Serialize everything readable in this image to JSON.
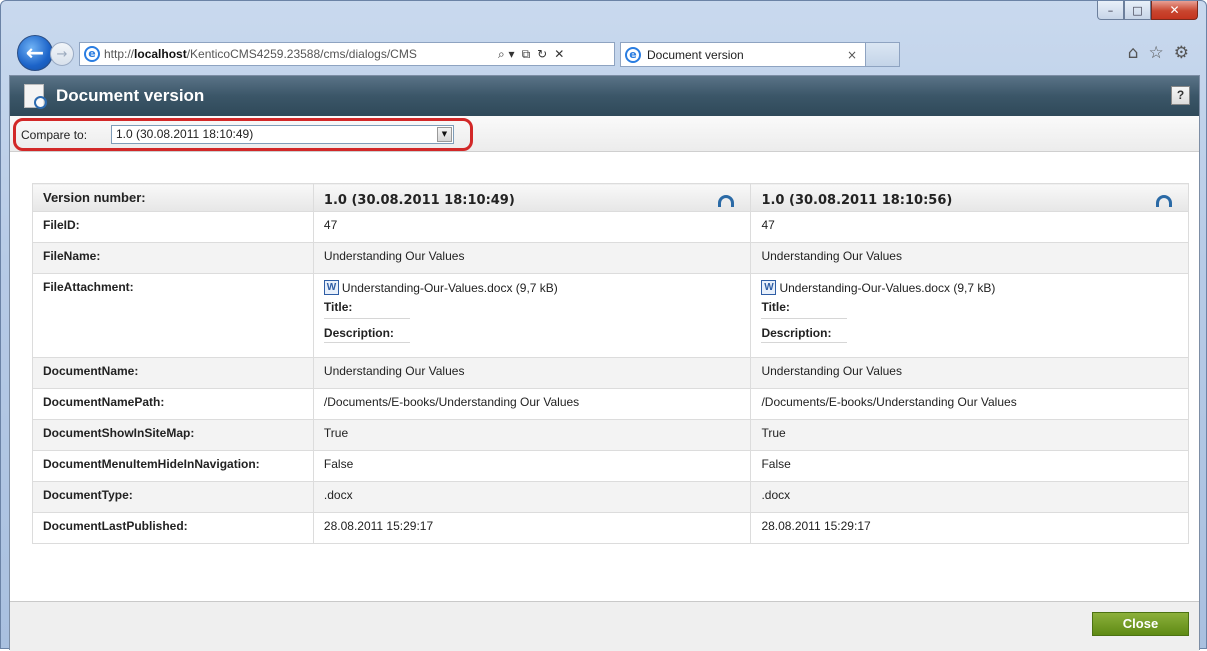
{
  "browser": {
    "url_prefix": "http://",
    "url_host": "localhost",
    "url_rest": "/KenticoCMS4259.23588/cms/dialogs/CMS",
    "tab_title": "Document version",
    "tab_close": "×",
    "addr_tools": [
      "⌕ ▾",
      "⧉",
      "↻",
      "✕"
    ],
    "tool_icons": [
      "⌂",
      "☆",
      "⚙"
    ],
    "back_glyph": "←",
    "forward_glyph": "→",
    "window_min": "–",
    "window_max": "□",
    "window_close": "✕"
  },
  "dialog": {
    "title": "Document version",
    "help_label": "?",
    "compare_label": "Compare to:",
    "compare_value": "1.0 (30.08.2011 18:10:49)",
    "close_label": "Close"
  },
  "table": {
    "header_label": "Version number:",
    "version_left": "1.0 (30.08.2011 18:10:49)",
    "version_right": "1.0 (30.08.2011 18:10:56)",
    "rows": [
      {
        "label": "FileID:",
        "left": "47",
        "right": "47"
      },
      {
        "label": "FileName:",
        "left": "Understanding Our Values",
        "right": "Understanding Our Values"
      },
      {
        "label": "FileAttachment:",
        "left": "Understanding-Our-Values.docx (9,7 kB)",
        "right": "Understanding-Our-Values.docx (9,7 kB)"
      },
      {
        "label": "DocumentName:",
        "left": "Understanding Our Values",
        "right": "Understanding Our Values"
      },
      {
        "label": "DocumentNamePath:",
        "left": "/Documents/E-books/Understanding Our Values",
        "right": "/Documents/E-books/Understanding Our Values"
      },
      {
        "label": "DocumentShowInSiteMap:",
        "left": "True",
        "right": "True"
      },
      {
        "label": "DocumentMenuItemHideInNavigation:",
        "left": "False",
        "right": "False"
      },
      {
        "label": "DocumentType:",
        "left": ".docx",
        "right": ".docx"
      },
      {
        "label": "DocumentLastPublished:",
        "left": "28.08.2011 15:29:17",
        "right": "28.08.2011 15:29:17"
      }
    ],
    "attachment_title_label": "Title:",
    "attachment_description_label": "Description:"
  },
  "colors": {
    "header_bar": "#3b5668",
    "close_button": "#6f9a1f",
    "highlight_ring": "#d22828"
  }
}
